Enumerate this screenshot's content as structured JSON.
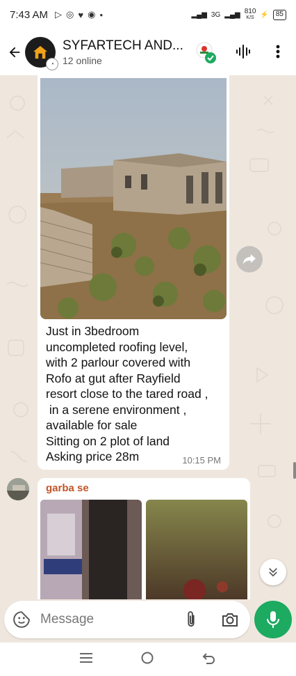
{
  "status_bar": {
    "time": "7:43 AM",
    "network": "3G",
    "speed": "810",
    "speed_unit": "K/S",
    "battery": "85"
  },
  "header": {
    "group_name": "SYFARTECH AND...",
    "online": "12 online"
  },
  "messages": [
    {
      "type": "image_with_caption",
      "caption_lines": [
        "Just in 3bedroom",
        "uncompleted roofing level,",
        "with 2 parlour covered with",
        "Rofo at gut after Rayfield",
        "resort close to the tared road ,",
        " in a serene environment ,",
        "available for sale",
        "Sitting on 2 plot of land",
        "Asking price 28m"
      ],
      "time": "10:15 PM"
    },
    {
      "type": "images",
      "sender": "garba se"
    }
  ],
  "input": {
    "placeholder": "Message"
  },
  "colors": {
    "accent": "#1daa61",
    "sender": "#c2552b",
    "chat_bg": "#efe7de"
  }
}
